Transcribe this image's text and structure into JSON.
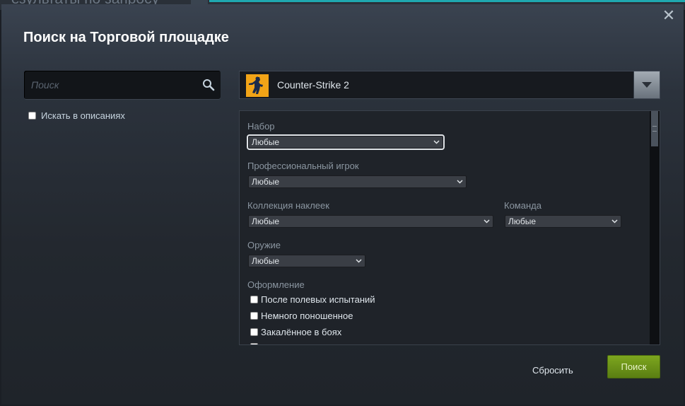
{
  "background": {
    "partial_text": "Р езультаты по запросу"
  },
  "dialog": {
    "title": "Поиск на Торговой площадке",
    "close_label": "✕"
  },
  "search": {
    "placeholder": "Поиск",
    "value": ""
  },
  "description_checkbox": {
    "label": "Искать в описаниях",
    "checked": false
  },
  "game": {
    "name": "Counter-Strike 2",
    "icon": "counter-strike-icon"
  },
  "filters": {
    "set": {
      "label": "Набор",
      "value": "Любые"
    },
    "pro_player": {
      "label": "Профессиональный игрок",
      "value": "Любые"
    },
    "sticker_collection": {
      "label": "Коллекция наклеек",
      "value": "Любые"
    },
    "team": {
      "label": "Команда",
      "value": "Любые"
    },
    "weapon": {
      "label": "Оружие",
      "value": "Любые"
    },
    "exterior": {
      "label": "Оформление",
      "options": [
        {
          "label": "После полевых испытаний",
          "checked": false
        },
        {
          "label": "Немного поношенное",
          "checked": false
        },
        {
          "label": "Закалённое в боях",
          "checked": false
        }
      ]
    }
  },
  "buttons": {
    "reset": "Сбросить",
    "search": "Поиск"
  },
  "colors": {
    "accent_green": "#7da61f",
    "game_icon_bg": "#f2a417",
    "dialog_bg": "#2b323c"
  }
}
